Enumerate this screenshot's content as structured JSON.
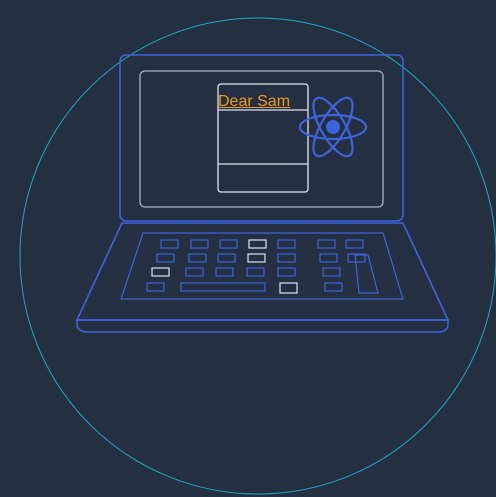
{
  "note": {
    "greeting": "Dear Sam"
  },
  "icons": {
    "logo": "atom-icon"
  },
  "colors": {
    "background": "#243041",
    "circle_outline": "#1fa8c9",
    "laptop_outline": "#3d63dd",
    "screen_outline": "#aab2c2",
    "key_highlight": "#dfe4ec",
    "greeting_text": "#f09a1c"
  }
}
